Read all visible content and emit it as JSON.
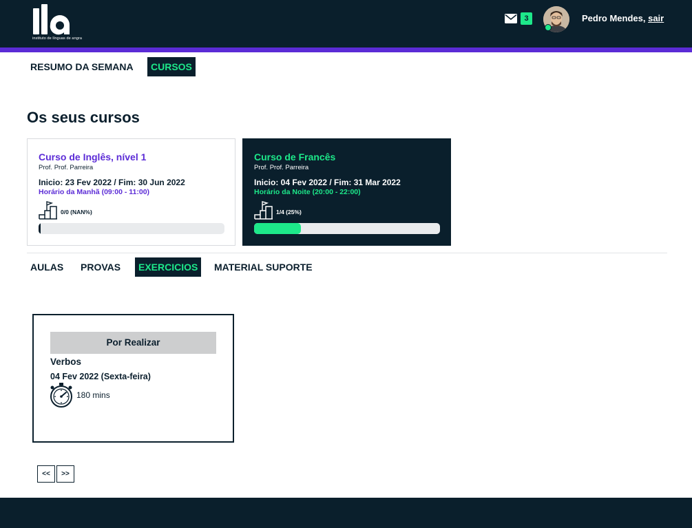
{
  "header": {
    "logo_text": "ila",
    "logo_caption": "instituto de línguas de angra",
    "unread_count": "3",
    "user_name": "Pedro Mendes,",
    "logout_label": "sair"
  },
  "nav": {
    "tabs": [
      {
        "label": "RESUMO DA SEMANA",
        "active": false
      },
      {
        "label": "CURSOS",
        "active": true
      }
    ]
  },
  "courses_section": {
    "title": "Os seus cursos"
  },
  "courses": [
    {
      "name": "Curso de Inglês, nível 1",
      "prof": "Prof. Prof. Parreira",
      "dates": "Inicio: 23 Fev 2022 / Fim: 30 Jun 2022",
      "schedule": "Horário da Manhã (09:00 - 11:00)",
      "progress_text": "0/0 (NAN%)",
      "progress_fraction": 0,
      "selected": false
    },
    {
      "name": "Curso de Francês",
      "prof": "Prof. Prof. Parreira",
      "dates": "Inicio: 04 Fev 2022 / Fim: 31 Mar 2022",
      "schedule": "Horário da Noite (20:00 - 22:00)",
      "progress_text": "1/4 (25%)",
      "progress_fraction": 0.25,
      "selected": true
    }
  ],
  "course_tabs": [
    {
      "label": "AULAS",
      "active": false
    },
    {
      "label": "PROVAS",
      "active": false
    },
    {
      "label": "EXERCICIOS",
      "active": true
    },
    {
      "label": "MATERIAL SUPORTE",
      "active": false
    }
  ],
  "exercise": {
    "status": "Por Realizar",
    "title": "Verbos",
    "date": "04 Fev 2022 (Sexta-feira)",
    "duration": "180 mins"
  },
  "pagination": {
    "prev_label": "<<",
    "next_label": ">>"
  },
  "colors": {
    "navy": "#0a1f2c",
    "purple": "#5b2bd6",
    "green": "#1de88a",
    "status_gray": "#cdcecf"
  },
  "icons": {
    "mail": "envelope-icon",
    "progress": "stairs-flag-icon",
    "timer": "stopwatch-icon"
  }
}
